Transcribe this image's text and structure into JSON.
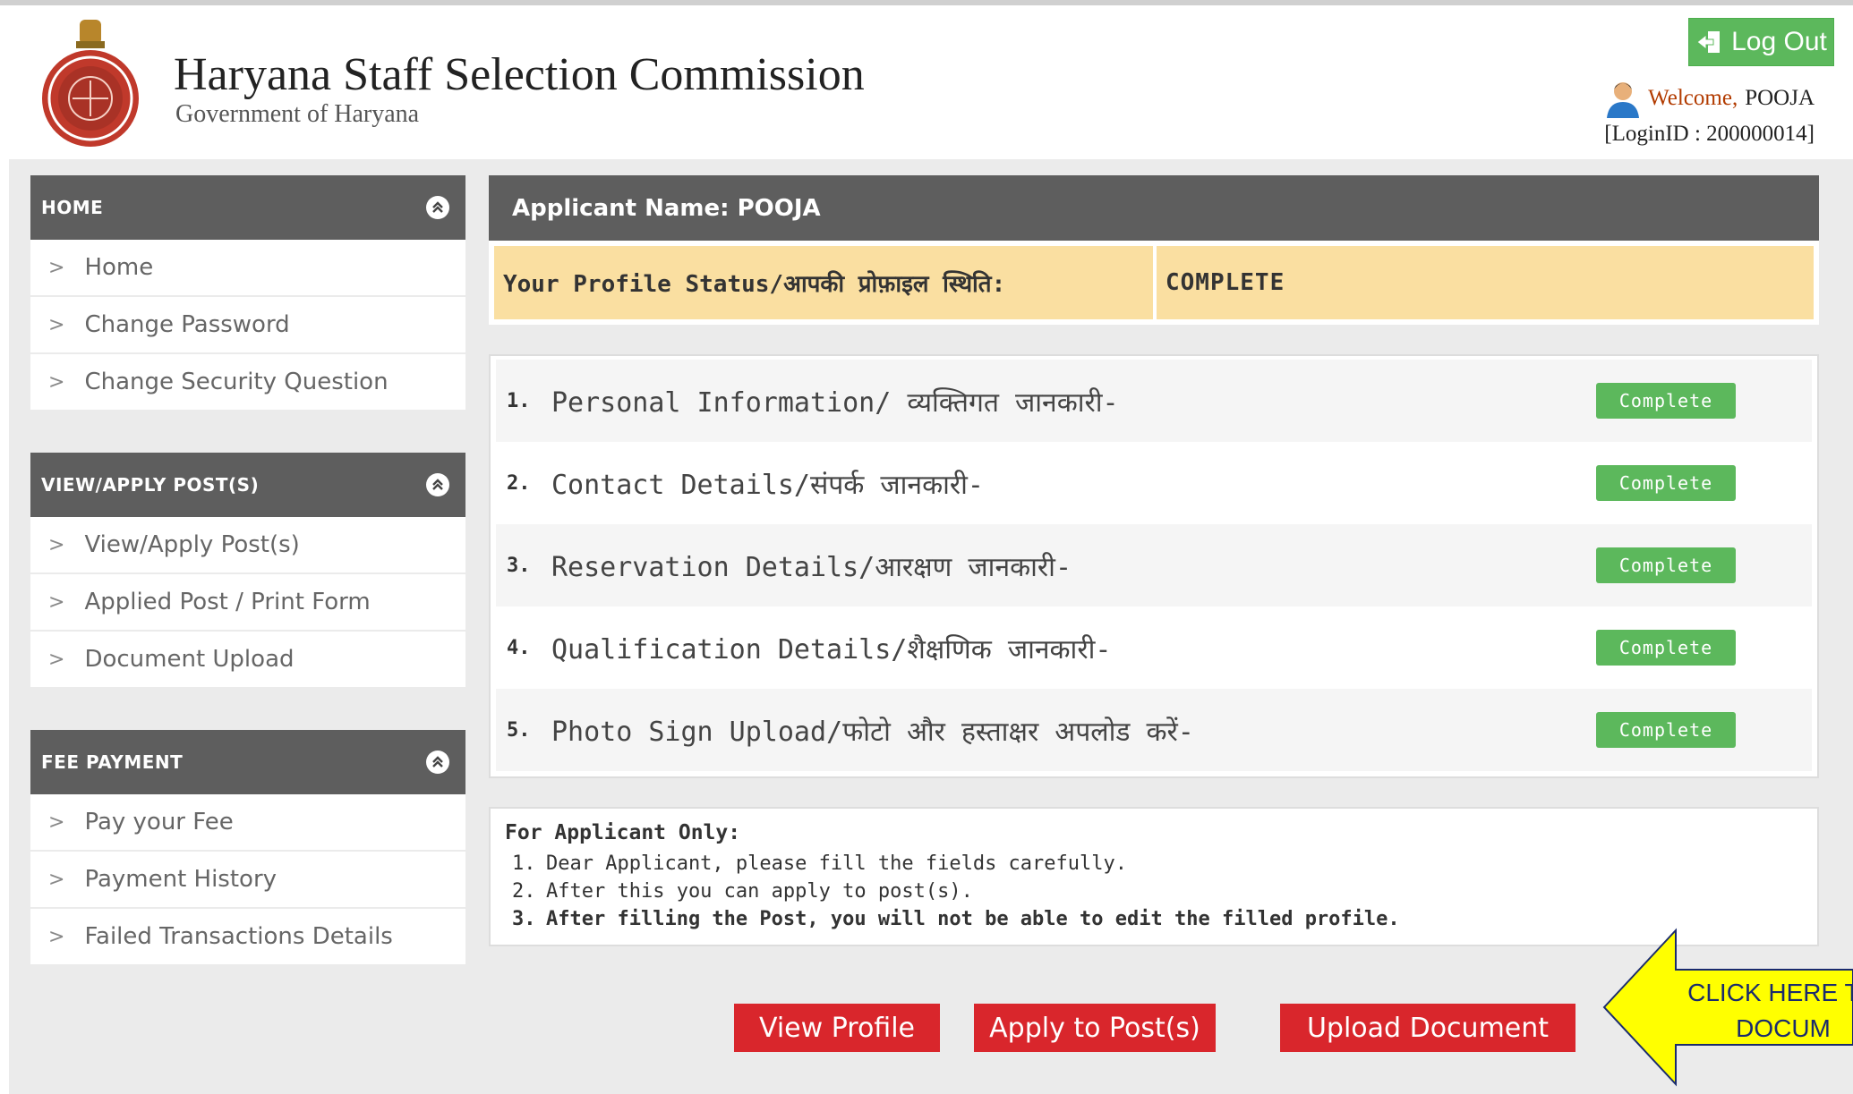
{
  "header": {
    "org_title": "Haryana Staff Selection Commission",
    "org_subtitle": "Government of Haryana",
    "logout_label": "Log Out",
    "welcome_prefix": "Welcome,",
    "welcome_name": "POOJA",
    "login_id": "[LoginID : 200000014]"
  },
  "sidebar": {
    "sections": [
      {
        "title": "HOME",
        "items": [
          "Home",
          "Change Password",
          "Change Security Question"
        ]
      },
      {
        "title": "VIEW/APPLY POST(S)",
        "items": [
          "View/Apply Post(s)",
          "Applied Post / Print Form",
          "Document Upload"
        ]
      },
      {
        "title": "FEE PAYMENT",
        "items": [
          "Pay your Fee",
          "Payment History",
          "Failed Transactions Details"
        ]
      }
    ]
  },
  "main": {
    "applicant_header": "Applicant Name: POOJA",
    "profile_status_label": "Your Profile Status/आपकी प्रोफ़ाइल स्थिति:",
    "profile_status_value": "COMPLETE",
    "sections": [
      {
        "num": "1.",
        "label": "Personal Information/ व्यक्तिगत जानकारी-",
        "status": "Complete"
      },
      {
        "num": "2.",
        "label": "Contact Details/संपर्क जानकारी-",
        "status": "Complete"
      },
      {
        "num": "3.",
        "label": "Reservation Details/आरक्षण जानकारी-",
        "status": "Complete"
      },
      {
        "num": "4.",
        "label": "Qualification Details/शैक्षणिक जानकारी-",
        "status": "Complete"
      },
      {
        "num": "5.",
        "label": "Photo Sign Upload/फोटो और हस्ताक्षर अपलोड करें-",
        "status": "Complete"
      }
    ],
    "notes": {
      "title": "For Applicant Only:",
      "items": [
        {
          "num": "1.",
          "text": "Dear Applicant, please fill the fields carefully."
        },
        {
          "num": "2.",
          "text": "After this you can apply to post(s)."
        },
        {
          "num": "3.",
          "text": "After filling the Post, you will not be able to edit the filled profile."
        }
      ]
    },
    "buttons": {
      "view_profile": "View Profile",
      "apply_posts": "Apply to Post(s)",
      "upload_document": "Upload Document"
    }
  },
  "callout": {
    "line1": "CLICK HERE TO",
    "line2": "DOCUM"
  },
  "colors": {
    "header_bar": "#5e5e5e",
    "status_bg": "#fadfa1",
    "badge_green": "#5cb85c",
    "button_red": "#d9262c",
    "callout_yellow": "#ffff00"
  }
}
